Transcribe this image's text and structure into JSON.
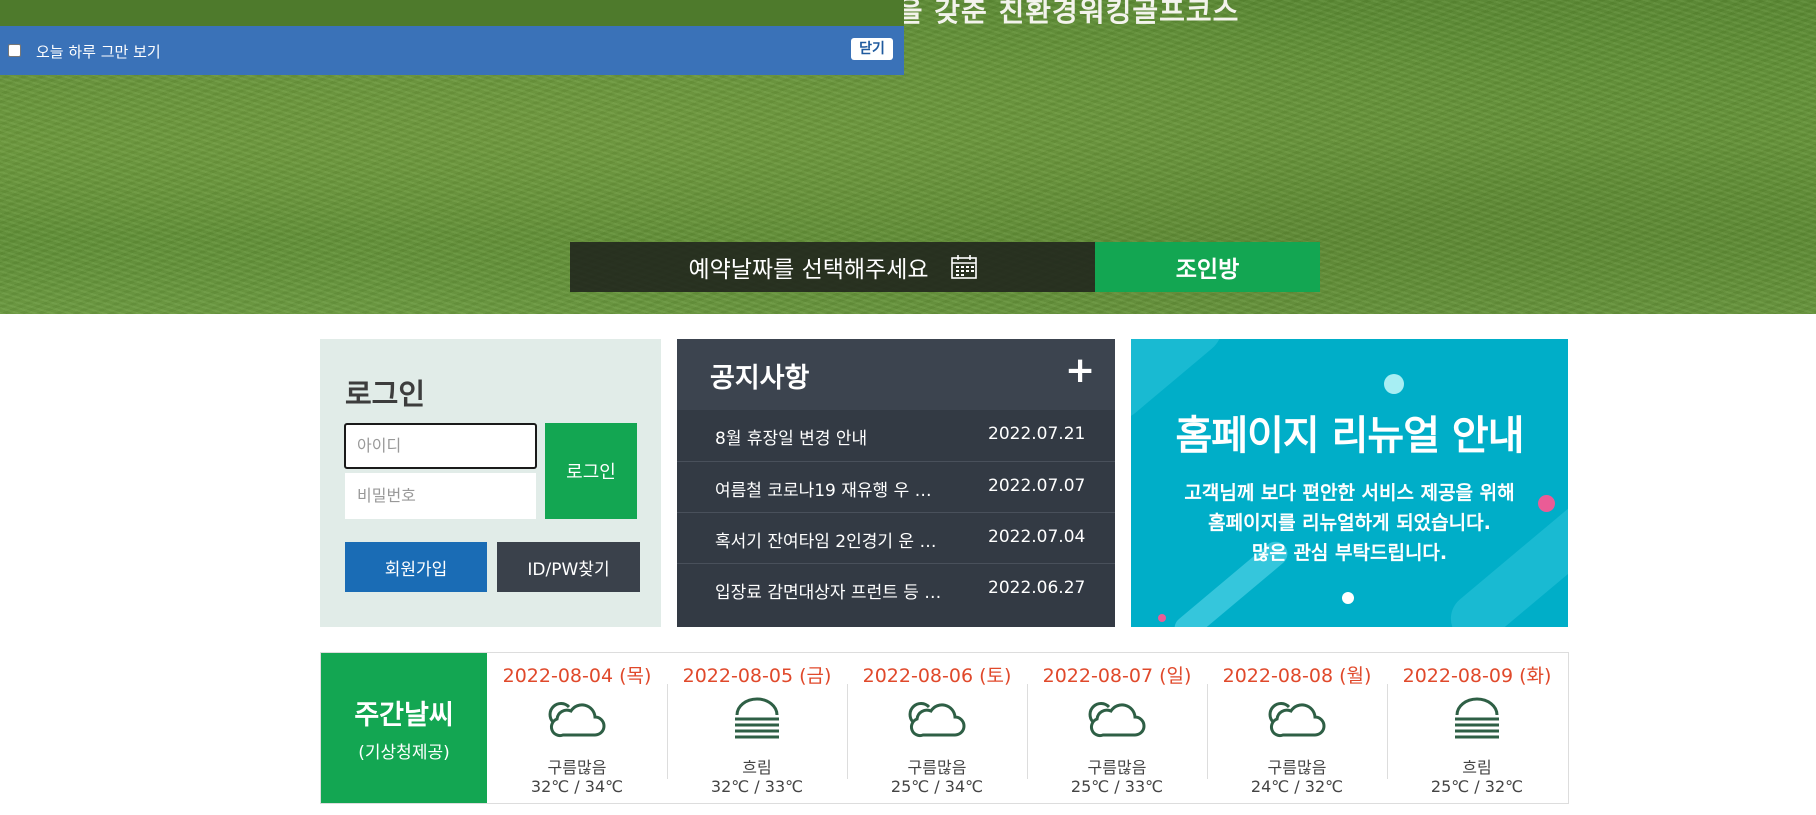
{
  "hero": {
    "slogan": "판을 갖춘 친환경워킹골프코스",
    "reservation_date_label": "예약날짜를 선택해주세요",
    "join_room_label": "조인방"
  },
  "popup": {
    "dont_show_today_label": "오늘 하루 그만 보기",
    "close_label": "닫기"
  },
  "login": {
    "title": "로그인",
    "id_placeholder": "아이디",
    "pw_placeholder": "비밀번호",
    "login_button": "로그인",
    "join_button": "회원가입",
    "find_button": "ID/PW찾기"
  },
  "notice": {
    "title": "공지사항",
    "more_label": "+",
    "items": [
      {
        "title": "8월 휴장일 변경 안내",
        "date": "2022.07.21"
      },
      {
        "title": "여름철 코로나19 재유행 우 …",
        "date": "2022.07.07"
      },
      {
        "title": "혹서기 잔여타임 2인경기 운 …",
        "date": "2022.07.04"
      },
      {
        "title": "입장료 감면대상자 프런트 등 …",
        "date": "2022.06.27"
      }
    ]
  },
  "banner": {
    "title": "홈페이지 리뉴얼 안내",
    "lines": [
      "고객님께 보다 편안한 서비스 제공을 위해",
      "홈페이지를 리뉴얼하게 되었습니다.",
      "많은 관심 부탁드립니다."
    ]
  },
  "weather": {
    "title": "주간날씨",
    "subtitle": "(기상청제공)",
    "days": [
      {
        "date": "2022-08-04 (목)",
        "condition": "구름많음",
        "temp": "32℃ / 34℃",
        "icon": "cloud-icon"
      },
      {
        "date": "2022-08-05 (금)",
        "condition": "흐림",
        "temp": "32℃ / 33℃",
        "icon": "overcast-icon"
      },
      {
        "date": "2022-08-06 (토)",
        "condition": "구름많음",
        "temp": "25℃ / 34℃",
        "icon": "cloud-icon"
      },
      {
        "date": "2022-08-07 (일)",
        "condition": "구름많음",
        "temp": "25℃ / 33℃",
        "icon": "cloud-icon"
      },
      {
        "date": "2022-08-08 (월)",
        "condition": "구름많음",
        "temp": "24℃ / 32℃",
        "icon": "cloud-icon"
      },
      {
        "date": "2022-08-09 (화)",
        "condition": "흐림",
        "temp": "25℃ / 32℃",
        "icon": "overcast-icon"
      }
    ]
  },
  "colors": {
    "brand_green": "#13a652",
    "brand_blue": "#1a6cb5",
    "dark_panel": "#333a44",
    "banner_cyan": "#00aec8",
    "date_red": "#e0492b",
    "icon_green": "#2e5f45"
  }
}
